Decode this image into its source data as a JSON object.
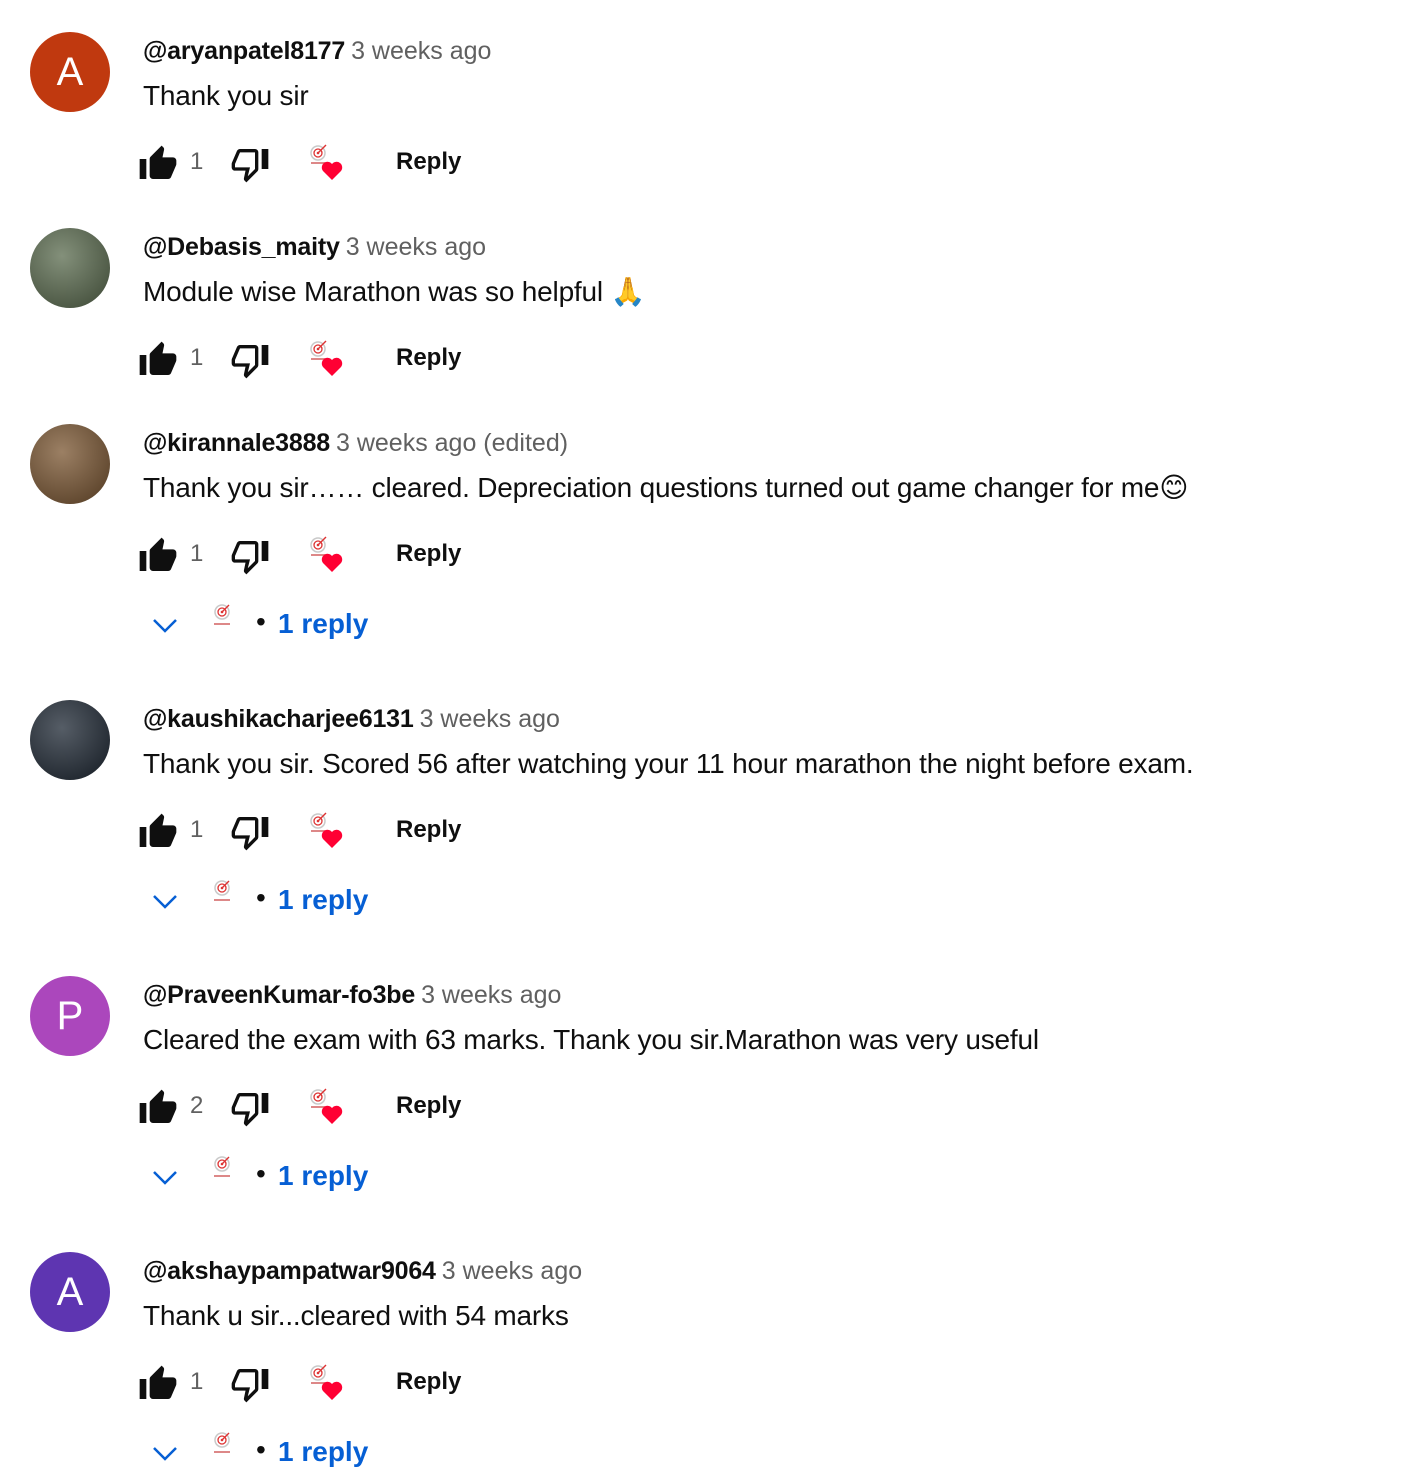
{
  "comments": [
    {
      "author": "@aryanpatel8177",
      "time": "3 weeks ago",
      "text": "Thank you sir",
      "likes": "1",
      "reply_label": "Reply",
      "avatar_letter": "A",
      "avatar_color": "#c0390f"
    },
    {
      "author": "@Debasis_maity",
      "time": "3 weeks ago",
      "text": "Module wise Marathon was so helpful 🙏",
      "likes": "1",
      "reply_label": "Reply",
      "avatar_letter": "",
      "avatar_color": "#5a6b4e"
    },
    {
      "author": "@kirannale3888",
      "time": "3 weeks ago (edited)",
      "text": "Thank you sir…… cleared. Depreciation questions turned out game changer for me😊",
      "likes": "1",
      "reply_label": "Reply",
      "avatar_letter": "",
      "avatar_color": "#7a5530",
      "replies": "1 reply"
    },
    {
      "author": "@kaushikacharjee6131",
      "time": "3 weeks ago",
      "text": "Thank you sir. Scored 56 after watching your 11 hour marathon the night before exam.",
      "likes": "1",
      "reply_label": "Reply",
      "avatar_letter": "",
      "avatar_color": "#1d2733",
      "replies": "1 reply"
    },
    {
      "author": "@PraveenKumar-fo3be",
      "time": "3 weeks ago",
      "text": "Cleared the exam with 63 marks. Thank you sir.Marathon was very useful",
      "likes": "2",
      "reply_label": "Reply",
      "avatar_letter": "P",
      "avatar_color": "#ab47bc",
      "replies": "1 reply"
    },
    {
      "author": "@akshaypampatwar9064",
      "time": "3 weeks ago",
      "text": "Thank u sir...cleared with 54 marks",
      "likes": "1",
      "reply_label": "Reply",
      "avatar_letter": "A",
      "avatar_color": "#5e35b1",
      "replies": "1 reply"
    }
  ],
  "icons": {
    "like": "thumbs-up-icon",
    "dislike": "thumbs-down-icon",
    "creator_heart": "creator-heart-icon",
    "expand": "chevron-down-icon"
  },
  "colors": {
    "link": "#065fd4",
    "muted": "#606060",
    "heart": "#ff0033"
  }
}
